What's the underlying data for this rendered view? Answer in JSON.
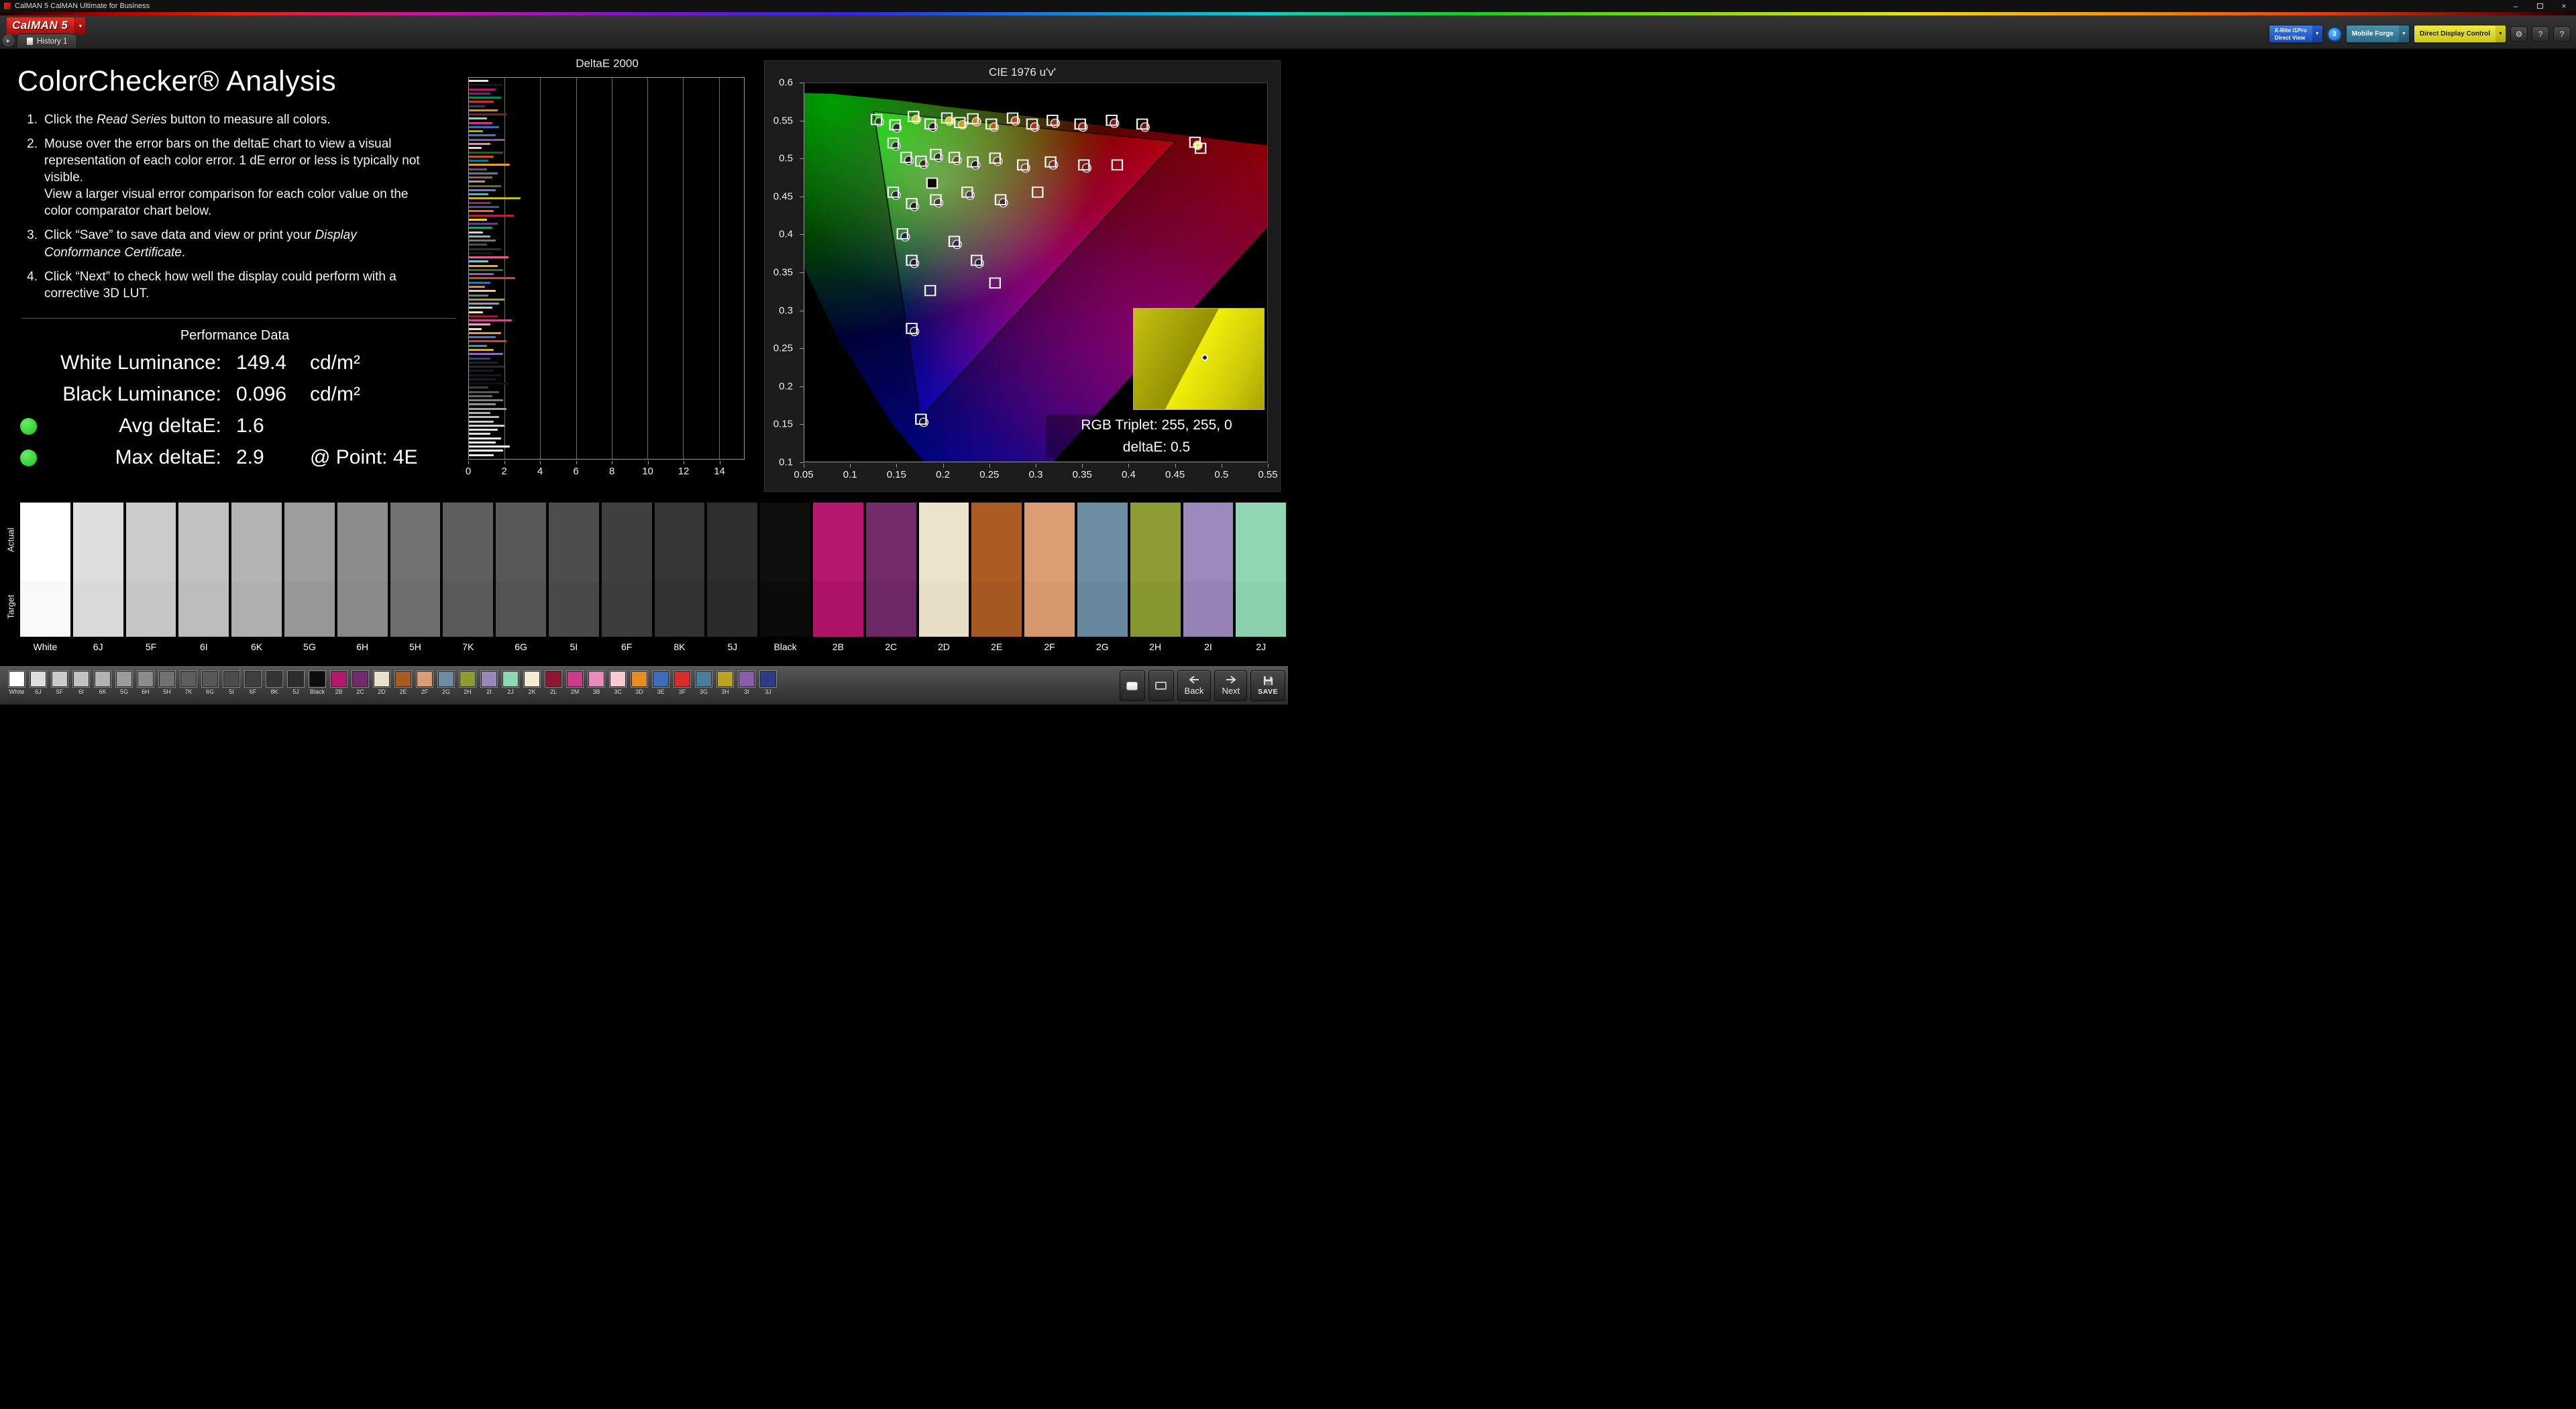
{
  "window": {
    "title": "CalMAN 5 CalMAN Ultimate for Business"
  },
  "icons": {
    "chevron_down": "▼",
    "play": "▶",
    "gear": "⚙",
    "help": "?",
    "minimize": "–",
    "close": "×"
  },
  "header": {
    "logo": "CalMAN 5",
    "tab": "History 1",
    "meter": {
      "line1": "X-Rite i1Pro",
      "line2": "Direct View"
    },
    "meter_badge": "3",
    "source": "Mobile Forge",
    "display": "Direct Display Control"
  },
  "instructions": {
    "title": "ColorChecker® Analysis",
    "items": [
      [
        {
          "t": "Click the "
        },
        {
          "t": "Read Series",
          "i": true
        },
        {
          "t": " button to measure all colors."
        }
      ],
      [
        {
          "t": "Mouse over the error bars on the deltaE chart to view a visual representation of each color error. 1 dE error or less is typically not visible."
        },
        {
          "br": true
        },
        {
          "t": "View a larger visual error comparison for each color value on the color comparator chart below."
        }
      ],
      [
        {
          "t": "Click “Save” to save data and view or print your "
        },
        {
          "t": "Display Conformance Certificate",
          "i": true
        },
        {
          "t": "."
        }
      ],
      [
        {
          "t": "Click “Next” to check how well the display could perform with a corrective 3D LUT."
        }
      ]
    ]
  },
  "performance": {
    "title": "Performance Data",
    "status_color": "#1ec41e",
    "rows": [
      {
        "label": "White Luminance:",
        "value": "149.4",
        "extra": "cd/m²",
        "dot": false
      },
      {
        "label": "Black Luminance:",
        "value": "0.096",
        "extra": "cd/m²",
        "dot": false
      },
      {
        "label": "Avg deltaE:",
        "value": "1.6",
        "extra": "",
        "dot": true
      },
      {
        "label": "Max deltaE:",
        "value": "2.9",
        "extra": "@ Point: 4E",
        "dot": true
      }
    ]
  },
  "chart_data": [
    {
      "type": "bar",
      "orientation": "horizontal",
      "title": "DeltaE 2000",
      "xlim": [
        0,
        15.4
      ],
      "xticks": [
        0,
        2,
        4,
        6,
        8,
        10,
        12,
        14
      ],
      "grid": true,
      "bars": [
        [
          "#e8e8e8",
          1.1
        ],
        [
          "#161616",
          1.9
        ],
        [
          "#b01870",
          1.5
        ],
        [
          "#6f2a68",
          1.2
        ],
        [
          "#0a8a50",
          1.8
        ],
        [
          "#d82a2a",
          1.4
        ],
        [
          "#2a3a8a",
          0.9
        ],
        [
          "#e88a20",
          1.6
        ],
        [
          "#8a1530",
          2.1
        ],
        [
          "#90d5b1",
          1.0
        ],
        [
          "#c83a8a",
          1.3
        ],
        [
          "#3a6ab8",
          1.7
        ],
        [
          "#b8a020",
          0.8
        ],
        [
          "#4a7a9a",
          1.5
        ],
        [
          "#8a5aa8",
          2.0
        ],
        [
          "#e888b8",
          1.2
        ],
        [
          "#f8c8d0",
          0.7
        ],
        [
          "#2a5a2a",
          1.9
        ],
        [
          "#c8501e",
          1.4
        ],
        [
          "#00789a",
          1.1
        ],
        [
          "#e2a32c",
          2.3
        ],
        [
          "#9a3e70",
          1.0
        ],
        [
          "#5a7d9a",
          1.6
        ],
        [
          "#8a6a50",
          1.3
        ],
        [
          "#c5957b",
          0.9
        ],
        [
          "#5a6e38",
          1.8
        ],
        [
          "#8578ae",
          1.5
        ],
        [
          "#64a8bc",
          1.1
        ],
        [
          "#c8b820",
          2.9
        ],
        [
          "#a02078",
          1.2
        ],
        [
          "#3c5a98",
          1.7
        ],
        [
          "#e0701e",
          1.4
        ],
        [
          "#b82030",
          2.5
        ],
        [
          "#e8d820",
          1.0
        ],
        [
          "#6a3a8a",
          1.6
        ],
        [
          "#20a060",
          1.3
        ],
        [
          "#d0d0d0",
          0.8
        ],
        [
          "#a8a8a8",
          1.2
        ],
        [
          "#787878",
          1.5
        ],
        [
          "#505050",
          1.0
        ],
        [
          "#303030",
          1.8
        ],
        [
          "#181818",
          1.3
        ],
        [
          "#e85a90",
          2.2
        ],
        [
          "#70c8e0",
          1.1
        ],
        [
          "#f0a830",
          1.6
        ],
        [
          "#486830",
          1.9
        ],
        [
          "#9060c0",
          1.4
        ],
        [
          "#d84820",
          2.6
        ],
        [
          "#2878b0",
          1.2
        ],
        [
          "#b89868",
          0.9
        ],
        [
          "#e8c8a0",
          1.5
        ],
        [
          "#687898",
          1.1
        ],
        [
          "#98a830",
          2.0
        ],
        [
          "#a888c8",
          1.7
        ],
        [
          "#a0e0c0",
          1.3
        ],
        [
          "#f8e0b8",
          0.8
        ],
        [
          "#981838",
          1.6
        ],
        [
          "#d04898",
          2.4
        ],
        [
          "#f0a0c0",
          1.2
        ],
        [
          "#f8d8e0",
          0.7
        ],
        [
          "#f09828",
          1.8
        ],
        [
          "#4878c8",
          1.5
        ],
        [
          "#e03838",
          2.1
        ],
        [
          "#5888a8",
          1.0
        ],
        [
          "#c8b030",
          1.4
        ],
        [
          "#9868b8",
          1.9
        ],
        [
          "#303f90",
          1.2
        ],
        [
          "#202020",
          1.6
        ],
        [
          "#282828",
          2.0
        ],
        [
          "#1a1a1a",
          1.4
        ],
        [
          "#101828",
          1.8
        ],
        [
          "#182030",
          1.5
        ],
        [
          "#0f0f0f",
          2.2
        ],
        [
          "#404040",
          1.1
        ],
        [
          "#585858",
          1.7
        ],
        [
          "#686868",
          1.3
        ],
        [
          "#808080",
          1.9
        ],
        [
          "#909090",
          1.5
        ],
        [
          "#a0a0a0",
          2.1
        ],
        [
          "#b0b0b0",
          1.2
        ],
        [
          "#bcbcbc",
          1.7
        ],
        [
          "#c8c8c8",
          1.4
        ],
        [
          "#d4d4d4",
          2.0
        ],
        [
          "#dcdcdc",
          1.6
        ],
        [
          "#e4e4e4",
          1.2
        ],
        [
          "#ececf0",
          1.8
        ],
        [
          "#f4f4f4",
          1.5
        ],
        [
          "#f8f8f8",
          2.3
        ],
        [
          "#ffffff",
          1.9
        ],
        [
          "#f0f0e8",
          1.4
        ]
      ]
    },
    {
      "type": "scatter",
      "title": "CIE 1976 u'v'",
      "xlim": [
        0.05,
        0.55
      ],
      "ylim": [
        0.1,
        0.6
      ],
      "xticks": [
        0.05,
        0.1,
        0.15,
        0.2,
        0.25,
        0.3,
        0.35,
        0.4,
        0.45,
        0.5,
        0.55
      ],
      "yticks": [
        0.6,
        0.55,
        0.5,
        0.45,
        0.4,
        0.35,
        0.3,
        0.25,
        0.2,
        0.15,
        0.1
      ],
      "gamut_triangle": {
        "r": [
          0.4507,
          0.5229
        ],
        "g": [
          0.125,
          0.5625
        ],
        "b": [
          0.1754,
          0.1579
        ]
      },
      "targets": [
        [
          0.128,
          0.552
        ],
        [
          0.148,
          0.545
        ],
        [
          0.168,
          0.556
        ],
        [
          0.186,
          0.546
        ],
        [
          0.204,
          0.554
        ],
        [
          0.218,
          0.548
        ],
        [
          0.232,
          0.553
        ],
        [
          0.252,
          0.546
        ],
        [
          0.275,
          0.554
        ],
        [
          0.296,
          0.546
        ],
        [
          0.318,
          0.551
        ],
        [
          0.348,
          0.546
        ],
        [
          0.382,
          0.551
        ],
        [
          0.415,
          0.546
        ],
        [
          0.472,
          0.522
        ],
        [
          0.478,
          0.514
        ],
        [
          0.146,
          0.521
        ],
        [
          0.16,
          0.502
        ],
        [
          0.176,
          0.497
        ],
        [
          0.192,
          0.506
        ],
        [
          0.212,
          0.502
        ],
        [
          0.232,
          0.496
        ],
        [
          0.256,
          0.501
        ],
        [
          0.286,
          0.492
        ],
        [
          0.316,
          0.496
        ],
        [
          0.352,
          0.492
        ],
        [
          0.388,
          0.492
        ],
        [
          0.146,
          0.456
        ],
        [
          0.166,
          0.441
        ],
        [
          0.192,
          0.446
        ],
        [
          0.226,
          0.456
        ],
        [
          0.262,
          0.446
        ],
        [
          0.302,
          0.456
        ],
        [
          0.156,
          0.401
        ],
        [
          0.166,
          0.366
        ],
        [
          0.186,
          0.326
        ],
        [
          0.212,
          0.391
        ],
        [
          0.236,
          0.366
        ],
        [
          0.256,
          0.336
        ],
        [
          0.166,
          0.276
        ],
        [
          0.176,
          0.156
        ]
      ],
      "selected_target": [
        0.188,
        0.468
      ],
      "measurements": [
        [
          0.131,
          0.549,
          "#184a18"
        ],
        [
          0.15,
          0.541,
          "#2a2a2a"
        ],
        [
          0.171,
          0.552,
          "#c8d020"
        ],
        [
          0.189,
          0.542,
          "#1c1c1c"
        ],
        [
          0.207,
          0.55,
          "#d8c820"
        ],
        [
          0.221,
          0.545,
          "#c8a018"
        ],
        [
          0.236,
          0.549,
          "#d07818"
        ],
        [
          0.255,
          0.542,
          "#b86018"
        ],
        [
          0.278,
          0.55,
          "#c04818"
        ],
        [
          0.299,
          0.542,
          "#b83018"
        ],
        [
          0.321,
          0.547,
          "#a82818"
        ],
        [
          0.351,
          0.542,
          "#982018"
        ],
        [
          0.385,
          0.547,
          "#881818"
        ],
        [
          0.418,
          0.542,
          "#781018"
        ],
        [
          0.475,
          0.518,
          "#e8e020"
        ],
        [
          0.149,
          0.517,
          "#1c3018"
        ],
        [
          0.163,
          0.498,
          "#1c1c1c"
        ],
        [
          0.179,
          0.493,
          "#303018"
        ],
        [
          0.195,
          0.502,
          "#283828"
        ],
        [
          0.215,
          0.498,
          "#585018"
        ],
        [
          0.235,
          0.492,
          "#1c1c1c"
        ],
        [
          0.259,
          0.497,
          "#684018"
        ],
        [
          0.289,
          0.488,
          "#784828"
        ],
        [
          0.319,
          0.492,
          "#683028"
        ],
        [
          0.355,
          0.488,
          "#582020"
        ],
        [
          0.149,
          0.452,
          "#1c2838"
        ],
        [
          0.169,
          0.437,
          "#1c1c1c"
        ],
        [
          0.195,
          0.442,
          "#383838"
        ],
        [
          0.229,
          0.452,
          "#583848"
        ],
        [
          0.265,
          0.442,
          "#482838"
        ],
        [
          0.159,
          0.397,
          "#182848"
        ],
        [
          0.169,
          0.362,
          "#1c1c38"
        ],
        [
          0.215,
          0.387,
          "#382858"
        ],
        [
          0.239,
          0.362,
          "#282048"
        ],
        [
          0.169,
          0.272,
          "#181838"
        ],
        [
          0.179,
          0.152,
          "#101030"
        ]
      ],
      "tooltip": {
        "line1": "RGB Triplet: 255, 255, 0",
        "line2": "deltaE: 0.5"
      }
    }
  ],
  "comparator": {
    "row_labels": [
      "Actual",
      "Target"
    ],
    "patches": [
      {
        "label": "White",
        "actual": "#ffffff",
        "target": "#f9f9f9"
      },
      {
        "label": "6J",
        "actual": "#dedede",
        "target": "#d9d9d9"
      },
      {
        "label": "5F",
        "actual": "#cbcbcb",
        "target": "#c6c6c6"
      },
      {
        "label": "6I",
        "actual": "#c2c2c2",
        "target": "#bdbdbd"
      },
      {
        "label": "6K",
        "actual": "#b4b4b4",
        "target": "#afafaf"
      },
      {
        "label": "5G",
        "actual": "#9d9d9d",
        "target": "#989898"
      },
      {
        "label": "6H",
        "actual": "#8d8d8d",
        "target": "#898989"
      },
      {
        "label": "5H",
        "actual": "#727272",
        "target": "#6e6e6e"
      },
      {
        "label": "7K",
        "actual": "#5e5e5e",
        "target": "#5a5a5a"
      },
      {
        "label": "6G",
        "actual": "#585858",
        "target": "#545454"
      },
      {
        "label": "5I",
        "actual": "#4d4d4d",
        "target": "#494949"
      },
      {
        "label": "6F",
        "actual": "#404040",
        "target": "#3c3c3c"
      },
      {
        "label": "8K",
        "actual": "#363636",
        "target": "#323232"
      },
      {
        "label": "5J",
        "actual": "#2d2d2d",
        "target": "#2a2a2a"
      },
      {
        "label": "Black",
        "actual": "#0e0e0e",
        "target": "#0b0b0b"
      },
      {
        "label": "2B",
        "actual": "#b6186f",
        "target": "#ae1269"
      },
      {
        "label": "2C",
        "actual": "#732b6b",
        "target": "#6d2765"
      },
      {
        "label": "2D",
        "actual": "#ebe3cb",
        "target": "#e6dec6"
      },
      {
        "label": "2E",
        "actual": "#aa5d23",
        "target": "#a45821"
      },
      {
        "label": "2F",
        "actual": "#db9d73",
        "target": "#d5976d"
      },
      {
        "label": "2G",
        "actual": "#6d8da3",
        "target": "#67879d"
      },
      {
        "label": "2H",
        "actual": "#8d9d33",
        "target": "#87972f"
      },
      {
        "label": "2I",
        "actual": "#9d88bb",
        "target": "#9782b5"
      },
      {
        "label": "2J",
        "actual": "#92d7b3",
        "target": "#8cd1ad"
      }
    ]
  },
  "taskbar": {
    "swatches": [
      [
        "White",
        "#ffffff"
      ],
      [
        "6J",
        "#dddddd"
      ],
      [
        "5F",
        "#cacaca"
      ],
      [
        "6I",
        "#c1c1c1"
      ],
      [
        "6K",
        "#b3b3b3"
      ],
      [
        "5G",
        "#9c9c9c"
      ],
      [
        "6H",
        "#8c8c8c"
      ],
      [
        "5H",
        "#717171"
      ],
      [
        "7K",
        "#5d5d5d"
      ],
      [
        "6G",
        "#575757"
      ],
      [
        "5I",
        "#4c4c4c"
      ],
      [
        "6F",
        "#3f3f3f"
      ],
      [
        "8K",
        "#353535"
      ],
      [
        "5J",
        "#2c2c2c"
      ],
      [
        "Black",
        "#0d0d0d"
      ],
      [
        "2B",
        "#b5186e"
      ],
      [
        "2C",
        "#722a6a"
      ],
      [
        "2D",
        "#eae2ca"
      ],
      [
        "2E",
        "#a95c22"
      ],
      [
        "2F",
        "#da9c72"
      ],
      [
        "2G",
        "#6c8ca2"
      ],
      [
        "2H",
        "#8c9c32"
      ],
      [
        "2I",
        "#9c87ba"
      ],
      [
        "2J",
        "#91d6b2"
      ],
      [
        "2K",
        "#f5ead3"
      ],
      [
        "2L",
        "#8e1630"
      ],
      [
        "2M",
        "#c93c8c"
      ],
      [
        "3B",
        "#ea8aba"
      ],
      [
        "3C",
        "#f7cad2"
      ],
      [
        "3D",
        "#ea8c22"
      ],
      [
        "3E",
        "#3c6cba"
      ],
      [
        "3F",
        "#da2c2c"
      ],
      [
        "3G",
        "#4c7c9c"
      ],
      [
        "3H",
        "#baa222"
      ],
      [
        "3I",
        "#8c5caa"
      ],
      [
        "3J",
        "#2c3c8c"
      ]
    ],
    "buttons": {
      "back": "Back",
      "next": "Next",
      "save": "SAVE"
    }
  }
}
